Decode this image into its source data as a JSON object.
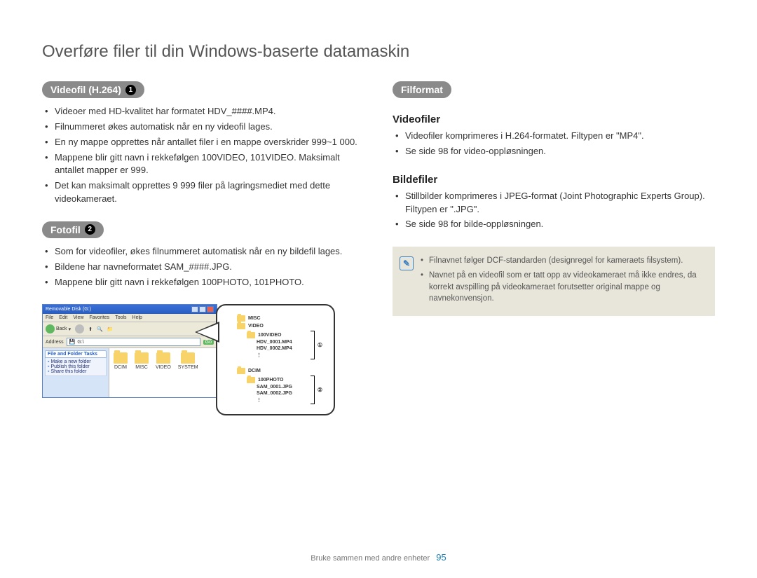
{
  "page_title": "Overføre filer til din Windows-baserte datamaskin",
  "left": {
    "sec1": {
      "pill": "Videofil (H.264)",
      "badge": "1",
      "bullets": [
        "Videoer med HD-kvalitet har formatet HDV_####.MP4.",
        "Filnummeret økes automatisk når en ny videofil lages.",
        "En ny mappe opprettes når antallet filer i en mappe overskrider 999~1 000.",
        "Mappene blir gitt navn i rekkefølgen 100VIDEO, 101VIDEO. Maksimalt antallet mapper er 999.",
        "Det kan maksimalt opprettes 9 999 filer på lagringsmediet med dette videokameraet."
      ]
    },
    "sec2": {
      "pill": "Fotofil",
      "badge": "2",
      "bullets": [
        "Som for videofiler, økes filnummeret automatisk når en ny bildefil lages.",
        "Bildene har navneformatet SAM_####.JPG.",
        "Mappene blir gitt navn i rekkefølgen 100PHOTO, 101PHOTO."
      ]
    }
  },
  "right": {
    "pill": "Filformat",
    "sub1": "Videofiler",
    "sub1_bullets": [
      "Videofiler komprimeres i H.264-formatet. Filtypen er \"MP4\".",
      "Se side 98 for video-oppløsningen."
    ],
    "sub2": "Bildefiler",
    "sub2_bullets": [
      "Stillbilder komprimeres i JPEG-format (Joint Photographic Experts Group). Filtypen er \".JPG\".",
      "Se side 98 for bilde-oppløsningen."
    ],
    "note": [
      "Filnavnet følger DCF-standarden (designregel for kameraets filsystem).",
      "Navnet på en videofil som er tatt opp av videokameraet må ikke endres, da korrekt avspilling på videokameraet forutsetter original mappe og navnekonvensjon."
    ]
  },
  "explorer": {
    "title": "Removable Disk (G:)",
    "menu": [
      "File",
      "Edit",
      "View",
      "Favorites",
      "Tools",
      "Help"
    ],
    "back": "Back",
    "address_label": "Address",
    "address_value": "G:\\",
    "go": "Go",
    "task_head": "File and Folder Tasks",
    "tasks": [
      "Make a new folder",
      "Publish this folder",
      "Share this folder"
    ],
    "folders": [
      "DCIM",
      "MISC",
      "VIDEO",
      "SYSTEM"
    ]
  },
  "tree": {
    "misc": "MISC",
    "video": "VIDEO",
    "v_folder": "100VIDEO",
    "v_f1": "HDV_0001.MP4",
    "v_f2": "HDV_0002.MP4",
    "dcim": "DCIM",
    "p_folder": "100PHOTO",
    "p_f1": "SAM_0001.JPG",
    "p_f2": "SAM_0002.JPG",
    "b1": "①",
    "b2": "②"
  },
  "footer": {
    "text": "Bruke sammen med andre enheter",
    "page": "95"
  }
}
